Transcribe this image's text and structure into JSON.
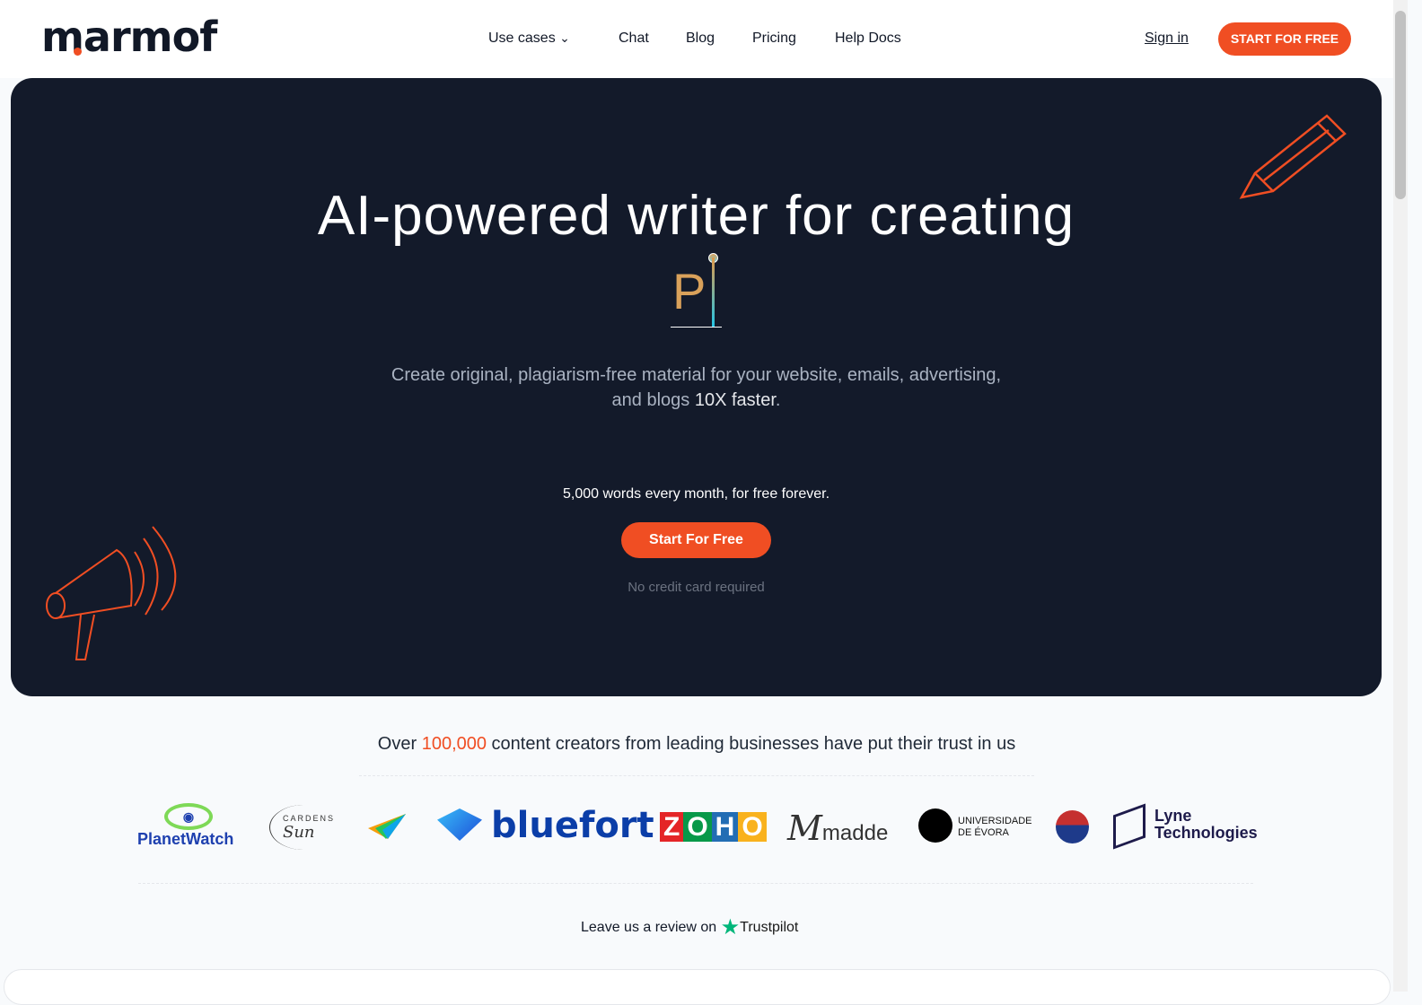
{
  "header": {
    "logo": "marmof",
    "nav": [
      {
        "label": "Use cases",
        "has_dropdown": true
      },
      {
        "label": "Chat"
      },
      {
        "label": "Blog"
      },
      {
        "label": "Pricing"
      },
      {
        "label": "Help Docs"
      }
    ],
    "sign_in": "Sign in",
    "cta": "START FOR FREE"
  },
  "hero": {
    "title": "AI-powered writer for creating",
    "typed_text": "P",
    "subtitle_1": "Create original, plagiarism-free material for your website, emails, advertising,",
    "subtitle_2_pre": "and blogs ",
    "subtitle_2_em": "10X faster",
    "subtitle_2_post": ".",
    "words": "5,000 words every month, for free forever.",
    "cta": "Start For Free",
    "note": "No credit card required"
  },
  "trust": {
    "pre": "Over ",
    "count": "100,000",
    "post": " content creators from leading businesses have put their trust in us"
  },
  "logos": [
    "PlanetWatch",
    "Gardens of the Sun",
    "",
    "bluefort",
    "ZOHO",
    "madde",
    "Universidade de Évora",
    "",
    "Lyne Technologies"
  ],
  "review": {
    "text": "Leave us a review on",
    "brand": "Trustpilot"
  },
  "colors": {
    "accent": "#f04e23",
    "hero_bg": "#131a2a",
    "trustpilot": "#00b67a"
  }
}
